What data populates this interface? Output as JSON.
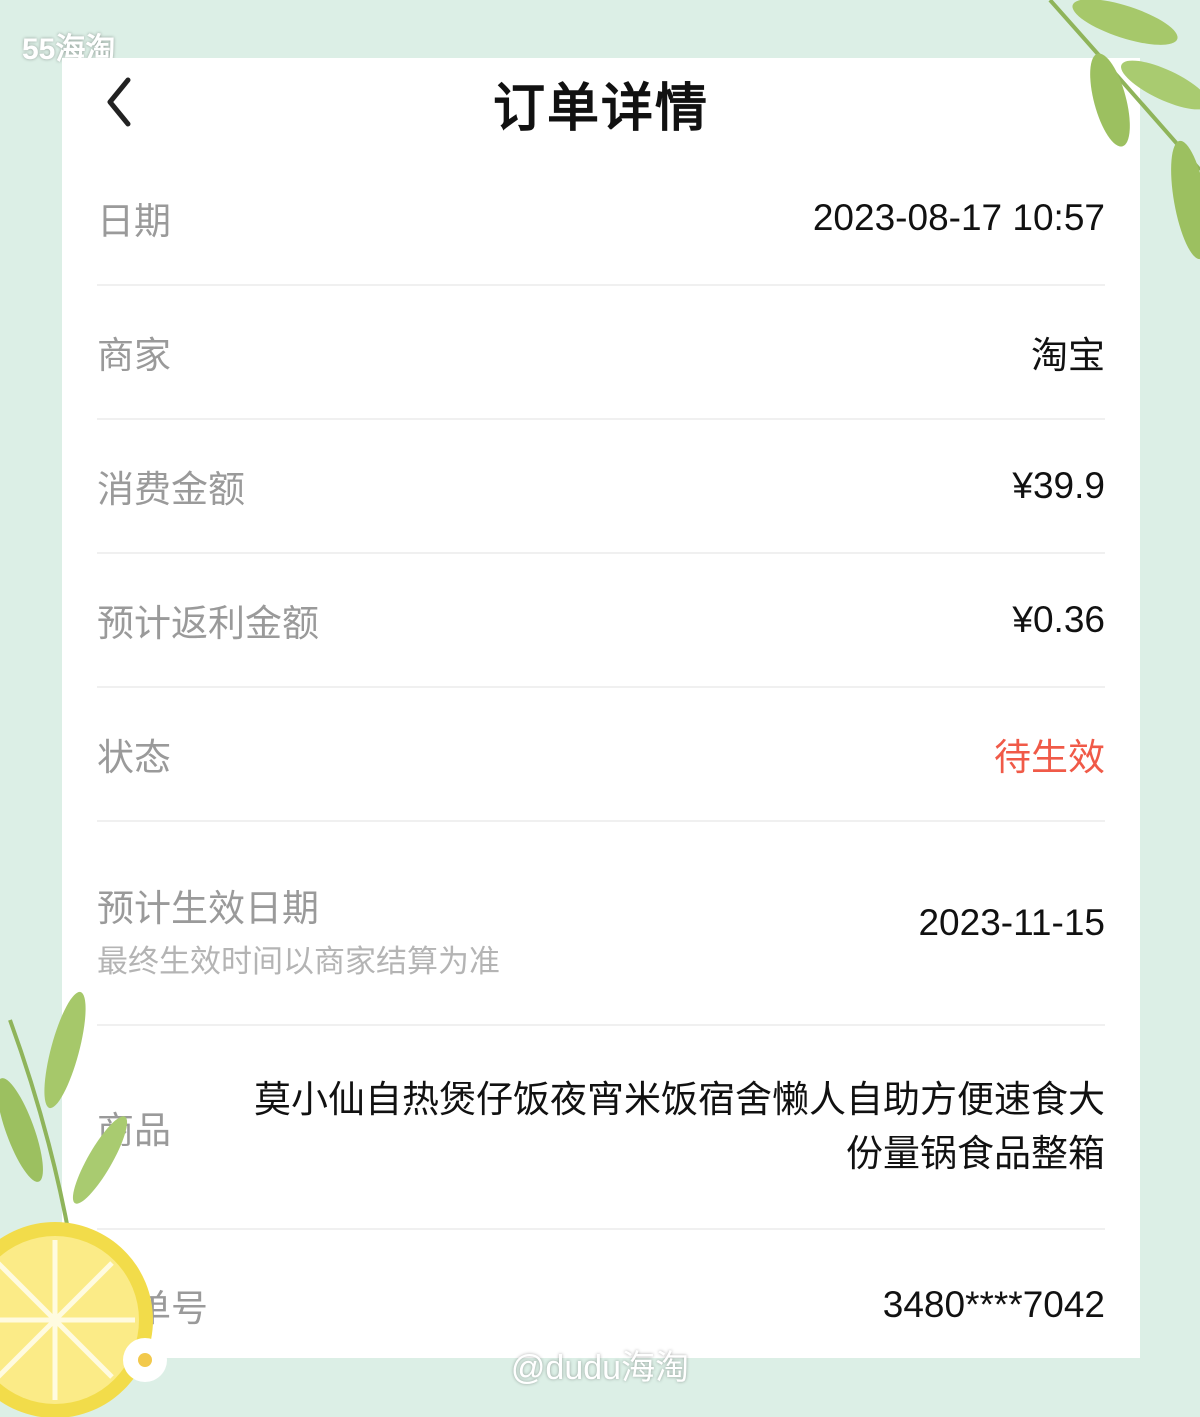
{
  "watermark_top": "55海淘",
  "watermark_bottom": "@dudu海淘",
  "header": {
    "title": "订单详情",
    "back_icon": "chevron-left-icon"
  },
  "rows": {
    "date": {
      "label": "日期",
      "value": "2023-08-17 10:57"
    },
    "merchant": {
      "label": "商家",
      "value": "淘宝"
    },
    "amount": {
      "label": "消费金额",
      "value": "¥39.9"
    },
    "rebate": {
      "label": "预计返利金额",
      "value": "¥0.36"
    },
    "status": {
      "label": "状态",
      "value": "待生效"
    },
    "effective": {
      "label": "预计生效日期",
      "sub": "最终生效时间以商家结算为准",
      "value": "2023-11-15"
    },
    "goods": {
      "label": "商品",
      "value": "莫小仙自热煲仔饭夜宵米饭宿舍懒人自助方便速食大份量锅食品整箱"
    },
    "order_no": {
      "label": "订单号",
      "value": "3480****7042"
    }
  },
  "colors": {
    "status": "#f05a48",
    "background": "#dcefe6",
    "card": "#ffffff"
  }
}
